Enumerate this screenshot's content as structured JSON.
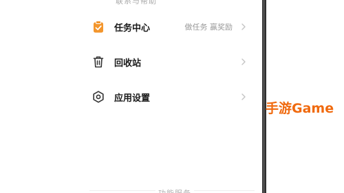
{
  "header": {
    "cut_text": "联系与帮助"
  },
  "menu": {
    "items": [
      {
        "label": "任务中心",
        "extra": "做任务 赢奖励",
        "icon": "task-clipboard-icon",
        "accent": "#F3962D"
      },
      {
        "label": "回收站",
        "extra": "",
        "icon": "trash-icon"
      },
      {
        "label": "应用设置",
        "extra": "",
        "icon": "settings-hexagon-icon"
      }
    ]
  },
  "footer": {
    "cut_text": "功能服务"
  },
  "watermark": {
    "text": "手游Game",
    "color": "#F06A0F"
  }
}
